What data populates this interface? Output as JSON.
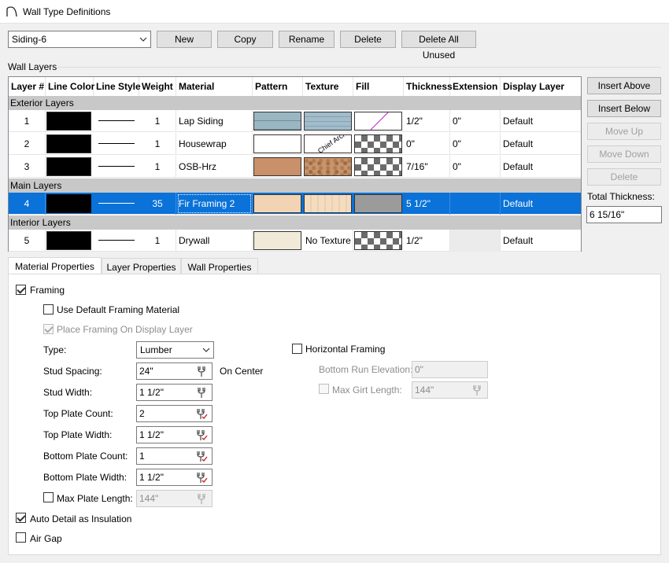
{
  "window": {
    "title": "Wall Type Definitions"
  },
  "toolbar": {
    "wall_type": "Siding-6",
    "new_label": "New",
    "copy_label": "Copy",
    "rename_label": "Rename",
    "delete_label": "Delete",
    "delete_all_unused_label": "Delete All Unused"
  },
  "wall_layers": {
    "group_label": "Wall Layers",
    "columns": [
      "Layer #",
      "Line Color",
      "Line Style",
      "Weight",
      "Material",
      "Pattern",
      "Texture",
      "Fill",
      "Thickness",
      "Extension",
      "Display Layer"
    ],
    "sections": {
      "exterior": "Exterior Layers",
      "main": "Main Layers",
      "interior": "Interior Layers"
    },
    "rows": [
      {
        "num": "1",
        "weight": "1",
        "material": "Lap Siding",
        "texture_text": "",
        "thickness": "1/2\"",
        "extension": "0\"",
        "display_layer": "Default"
      },
      {
        "num": "2",
        "weight": "1",
        "material": "Housewrap",
        "texture_text": "",
        "thickness": "0\"",
        "extension": "0\"",
        "display_layer": "Default"
      },
      {
        "num": "3",
        "weight": "1",
        "material": "OSB-Hrz",
        "texture_text": "",
        "thickness": "7/16\"",
        "extension": "0\"",
        "display_layer": "Default"
      },
      {
        "num": "4",
        "weight": "35",
        "material": "Fir Framing 2",
        "texture_text": "",
        "thickness": "5 1/2\"",
        "extension": "",
        "display_layer": "Default"
      },
      {
        "num": "5",
        "weight": "1",
        "material": "Drywall",
        "texture_text": "No Texture",
        "thickness": "1/2\"",
        "extension": "",
        "display_layer": "Default"
      }
    ],
    "housewrap_texture_text": "Chief Arch",
    "selected_color": "#0a72d8"
  },
  "side_buttons": {
    "insert_above": "Insert Above",
    "insert_below": "Insert Below",
    "move_up": "Move Up",
    "move_down": "Move Down",
    "delete": "Delete",
    "total_thickness_label": "Total Thickness:",
    "total_thickness_value": "6 15/16\""
  },
  "tabs": [
    "Material Properties",
    "Layer Properties",
    "Wall Properties"
  ],
  "material_properties": {
    "framing_label": "Framing",
    "use_default_label": "Use Default Framing Material",
    "place_on_display_label": "Place Framing On Display Layer",
    "type_label": "Type:",
    "type_value": "Lumber",
    "stud_spacing_label": "Stud Spacing:",
    "stud_spacing_value": "24\"",
    "on_center_label": "On Center",
    "stud_width_label": "Stud Width:",
    "stud_width_value": "1 1/2\"",
    "top_plate_count_label": "Top Plate Count:",
    "top_plate_count_value": "2",
    "top_plate_width_label": "Top Plate Width:",
    "top_plate_width_value": "1 1/2\"",
    "bottom_plate_count_label": "Bottom Plate Count:",
    "bottom_plate_count_value": "1",
    "bottom_plate_width_label": "Bottom Plate Width:",
    "bottom_plate_width_value": "1 1/2\"",
    "max_plate_length_label": "Max Plate Length:",
    "max_plate_length_value": "144\"",
    "horizontal_framing_label": "Horizontal Framing",
    "bottom_run_label": "Bottom Run Elevation:",
    "bottom_run_value": "0\"",
    "max_girt_label": "Max Girt Length:",
    "max_girt_value": "144\"",
    "auto_detail_label": "Auto Detail as Insulation",
    "air_gap_label": "Air Gap"
  }
}
